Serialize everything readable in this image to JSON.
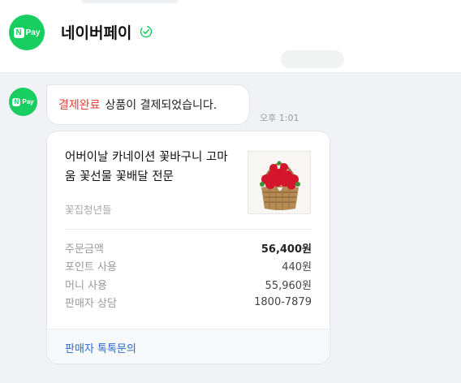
{
  "header": {
    "title": "네이버페이",
    "avatar_brand": {
      "n": "N",
      "pay": "Pay"
    }
  },
  "message": {
    "avatar_brand": {
      "n": "N",
      "pay": "Pay"
    },
    "status": "결제완료",
    "text": "상품이 결제되었습니다.",
    "time": "오후 1:01"
  },
  "order_card": {
    "product_name": "어버이날 카네이션 꽃바구니 고마움 꽃선물 꽃배달 전문",
    "seller": "꽃집청년들",
    "product_image": "red-carnation-basket",
    "details": [
      {
        "label": "주문금액",
        "value": "56,400원",
        "emphasis": true
      },
      {
        "label": "포인트 사용",
        "value": "440원",
        "emphasis": false
      },
      {
        "label": "머니 사용",
        "value": "55,960원",
        "emphasis": false
      },
      {
        "label": "판매자 상담",
        "value": "1800-7879",
        "emphasis": false
      }
    ],
    "footer_link": "판매자 톡톡문의"
  },
  "colors": {
    "brand_green": "#19ce60",
    "status_red": "#e8403a",
    "link_blue": "#2c6bcf",
    "background": "#f0f2f6"
  }
}
